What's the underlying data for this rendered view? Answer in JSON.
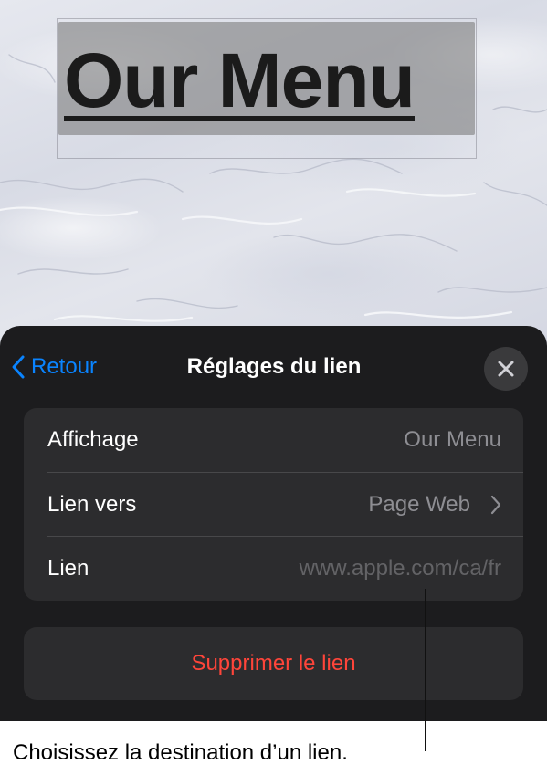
{
  "document": {
    "title_text": "Our Menu"
  },
  "popover": {
    "back_label": "Retour",
    "title": "Réglages du lien",
    "close_icon": "xmark-icon",
    "rows": [
      {
        "label": "Affichage",
        "value": "Our Menu"
      },
      {
        "label": "Lien vers",
        "value": "Page Web",
        "icon": "chevron-right-icon"
      },
      {
        "label": "Lien",
        "value": "www.apple.com/ca/fr"
      }
    ],
    "delete_label": "Supprimer le lien"
  },
  "callout": {
    "caption": "Choisissez la destination d’un lien."
  },
  "colors": {
    "accent": "#0a84ff",
    "destructive": "#ff453a",
    "sheet_background": "#1c1c1e",
    "group_background": "#2c2c2e",
    "secondary_text": "#8e8e93"
  }
}
